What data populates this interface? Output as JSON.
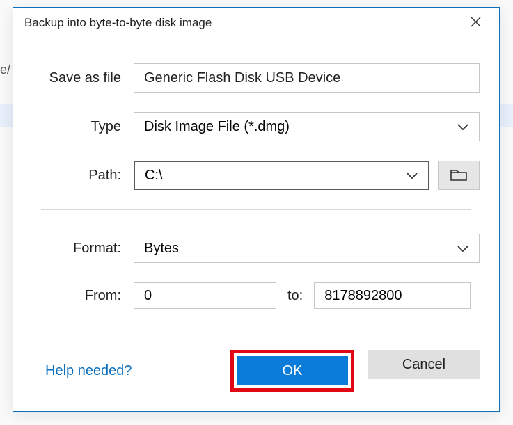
{
  "dialog": {
    "title": "Backup into byte-to-byte disk image",
    "labels": {
      "saveAs": "Save as file",
      "type": "Type",
      "path": "Path:",
      "format": "Format:",
      "from": "From:",
      "to": "to:"
    },
    "values": {
      "saveAs": "Generic Flash Disk USB Device",
      "type": "Disk Image File (*.dmg)",
      "path": "C:\\",
      "format": "Bytes",
      "from": "0",
      "to": "8178892800"
    },
    "footer": {
      "help": "Help needed?",
      "ok": "OK",
      "cancel": "Cancel"
    }
  },
  "bg": {
    "pathFragment": "e/"
  }
}
